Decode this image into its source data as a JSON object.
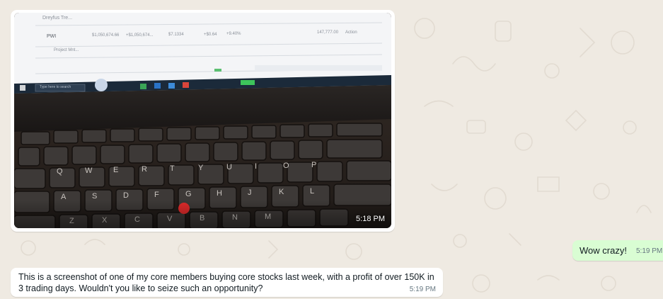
{
  "chat": {
    "incoming_image": {
      "time": "5:18 PM",
      "screen_texts": {
        "row_label_1": "Dreyfus Tre...",
        "row_symbol": "PWI",
        "row_value_1": "$1,050,674.66",
        "row_value_2": "+$1,050,674...",
        "row_value_3": "$7.1334",
        "row_value_4": "+$0.64",
        "row_value_5": "+9.40%",
        "row_value_6": "147,777.00",
        "row_action": "Action",
        "row_label_2": "Project Mnt...",
        "search_placeholder": "Type here to search"
      }
    },
    "outgoing": {
      "text": "Wow crazy!",
      "time": "5:19 PM"
    },
    "incoming_text": {
      "text": "This is a screenshot of one of my core members buying core stocks last week, with a profit of over 150K in 3 trading days. Wouldn't you like to seize such an opportunity?",
      "time": "5:19 PM"
    }
  },
  "keyboard": {
    "row1": [
      "Q",
      "W",
      "E",
      "R",
      "T",
      "Y",
      "U",
      "I",
      "O",
      "P"
    ],
    "row2": [
      "A",
      "S",
      "D",
      "F",
      "G",
      "H",
      "J",
      "K",
      "L"
    ],
    "row3": [
      "Z",
      "X",
      "C",
      "V",
      "B",
      "N",
      "M"
    ]
  },
  "colors": {
    "wallpaper": "#efeae2",
    "outgoing_bubble": "#d9fdd3",
    "incoming_bubble": "#ffffff",
    "trackpoint": "#e02b2b"
  }
}
